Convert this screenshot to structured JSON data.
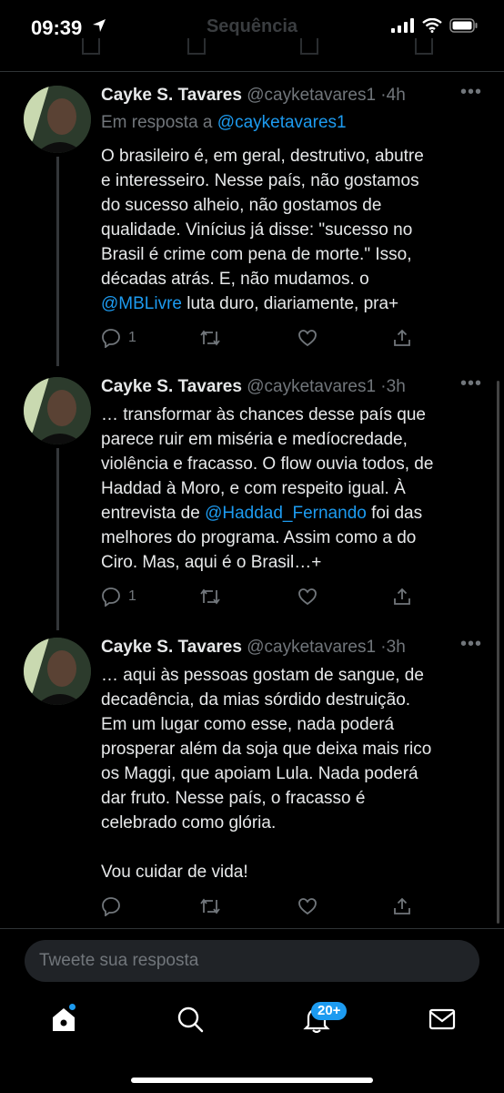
{
  "status_bar": {
    "time": "09:39"
  },
  "header": {
    "title": "Sequência"
  },
  "tweets": [
    {
      "name": "Cayke S. Tavares",
      "handle": "@cayketavares1",
      "time": "4h",
      "reply_to_prefix": "Em resposta a",
      "reply_to_handle": "@cayketavares1",
      "lines": [
        "O brasileiro é, em geral, destrutivo, abutre",
        "e interesseiro. Nesse país, não gostamos",
        "do sucesso alheio, não gostamos de",
        "qualidade. Vinícius já disse: \"sucesso no",
        "Brasil é crime com pena de morte.\" Isso,",
        "décadas atrás. E, não mudamos. o"
      ],
      "last_line_mention": "@MBLivre",
      "last_line_rest": " luta duro, diariamente, pra+",
      "reply_count": "1"
    },
    {
      "name": "Cayke S. Tavares",
      "handle": "@cayketavares1",
      "time": "3h",
      "lines_before": [
        "… transformar às chances desse país que",
        "parece ruir em miséria e medíocredade,",
        "violência e fracasso. O flow ouvia todos, de",
        "Haddad à Moro, e com respeito igual. À"
      ],
      "mid_prefix": "entrevista de ",
      "mid_mention": "@Haddad_Fernando",
      "mid_rest": " foi das",
      "lines_after": [
        "melhores do programa. Assim como a do",
        "Ciro. Mas, aqui é o Brasil…+"
      ],
      "reply_count": "1"
    },
    {
      "name": "Cayke S. Tavares",
      "handle": "@cayketavares1",
      "time": "3h",
      "lines": [
        "… aqui às pessoas gostam de sangue, de",
        "decadência, da mias sórdido destruição.",
        "Em um lugar como esse, nada poderá",
        "prosperar além da soja que deixa mais rico",
        "os Maggi, que apoiam Lula. Nada poderá",
        "dar fruto. Nesse país, o fracasso é",
        "celebrado como glória."
      ],
      "final_line": "Vou cuidar de vida!"
    }
  ],
  "reply_box": {
    "placeholder": "Tweete sua resposta"
  },
  "bottom_nav": {
    "notifications_badge": "20+"
  },
  "colors": {
    "accent": "#1d9bf0",
    "background": "#000000",
    "muted": "#71767b"
  }
}
